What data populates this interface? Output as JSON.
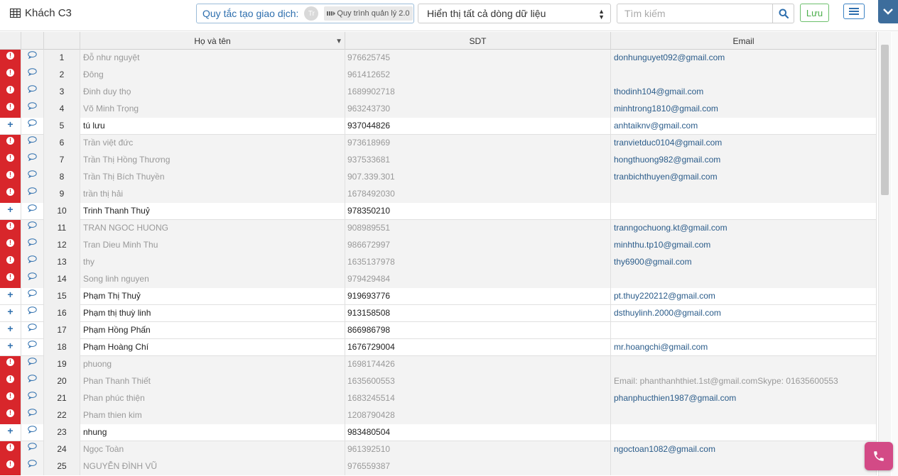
{
  "header": {
    "title": "Khách C3",
    "rule_label": "Quy tắc tạo giao dịch:",
    "rule_avatar": "Tr",
    "rule_tag": "Quy trình quản lý 2.0",
    "display_select": "Hiển thị tất cả dòng dữ liệu",
    "search_placeholder": "Tìm kiếm",
    "save_label": "Lưu"
  },
  "columns": [
    "Họ và tên",
    "SDT",
    "Email"
  ],
  "rows": [
    {
      "status": "error",
      "num": "1",
      "name": "Đỗ như nguyệt",
      "phone": "976625745",
      "email": "donhunguyet092@gmail.com"
    },
    {
      "status": "error",
      "num": "2",
      "name": "Đông",
      "phone": "961412652",
      "email": ""
    },
    {
      "status": "error",
      "num": "3",
      "name": "Đinh duy thọ",
      "phone": "1689902718",
      "email": "thodinh104@gmail.com"
    },
    {
      "status": "error",
      "num": "4",
      "name": "Võ Minh Trọng",
      "phone": "963243730",
      "email": "minhtrong1810@gmail.com"
    },
    {
      "status": "add",
      "num": "5",
      "name": "tú lưu",
      "phone": "937044826",
      "email": "anhtaiknv@gmail.com"
    },
    {
      "status": "error",
      "num": "6",
      "name": "Trần việt đức",
      "phone": "973618969",
      "email": "tranvietduc0104@gmail.com"
    },
    {
      "status": "error",
      "num": "7",
      "name": "Trần Thị Hồng Thương",
      "phone": "937533681",
      "email": "hongthuong982@gmail.com"
    },
    {
      "status": "error",
      "num": "8",
      "name": "Trần Thị Bích Thuyền",
      "phone": "907.339.301",
      "email": "tranbichthuyen@gmail.com"
    },
    {
      "status": "error",
      "num": "9",
      "name": "trần thị hải",
      "phone": "1678492030",
      "email": ""
    },
    {
      "status": "add",
      "num": "10",
      "name": "Trinh Thanh Thuỷ",
      "phone": "978350210",
      "email": ""
    },
    {
      "status": "error",
      "num": "11",
      "name": "TRAN NGOC HUONG",
      "phone": "908989551",
      "email": "tranngochuong.kt@gmail.com"
    },
    {
      "status": "error",
      "num": "12",
      "name": "Tran Dieu Minh Thu",
      "phone": "986672997",
      "email": "minhthu.tp10@gmail.com"
    },
    {
      "status": "error",
      "num": "13",
      "name": "thy",
      "phone": "1635137978",
      "email": "thy6900@gmail.com"
    },
    {
      "status": "error",
      "num": "14",
      "name": "Song linh nguyen",
      "phone": "979429484",
      "email": ""
    },
    {
      "status": "add",
      "num": "15",
      "name": "Phạm Thị Thuỷ",
      "phone": "919693776",
      "email": "pt.thuy220212@gmail.com"
    },
    {
      "status": "add",
      "num": "16",
      "name": "Phạm thị thuỳ linh",
      "phone": "913158508",
      "email": "dsthuylinh.2000@gmail.com"
    },
    {
      "status": "add",
      "num": "17",
      "name": "Phạm Hồng Phấn",
      "phone": "866986798",
      "email": ""
    },
    {
      "status": "add",
      "num": "18",
      "name": "Phạm Hoàng Chí",
      "phone": "1676729004",
      "email": "mr.hoangchi@gmail.com"
    },
    {
      "status": "error",
      "num": "19",
      "name": "phuong",
      "phone": "1698174426",
      "email": ""
    },
    {
      "status": "error",
      "num": "20",
      "name": "Phan Thanh Thiết",
      "phone": "1635600553",
      "email": "Email: phanthanhthiet.1st@gmail.comSkype: 01635600553",
      "email_muted": true
    },
    {
      "status": "error",
      "num": "21",
      "name": "Phan phúc thiện",
      "phone": "1683245514",
      "email": "phanphucthien1987@gmail.com"
    },
    {
      "status": "error",
      "num": "22",
      "name": "Pham thien kim",
      "phone": "1208790428",
      "email": ""
    },
    {
      "status": "add",
      "num": "23",
      "name": "nhung",
      "phone": "983480504",
      "email": ""
    },
    {
      "status": "error",
      "num": "24",
      "name": "Ngọc Toàn",
      "phone": "961392510",
      "email": "ngoctoan1082@gmail.com"
    },
    {
      "status": "error",
      "num": "25",
      "name": "NGUYỄN ĐÌNH VŨ",
      "phone": "976559387",
      "email": ""
    }
  ],
  "colors": {
    "error_flag": "#d8262b",
    "add_icon": "#2e6fae",
    "email_link": "#2b5c8a",
    "phone_fab": "#d34a86",
    "collapse_button": "#3d6d9c"
  }
}
